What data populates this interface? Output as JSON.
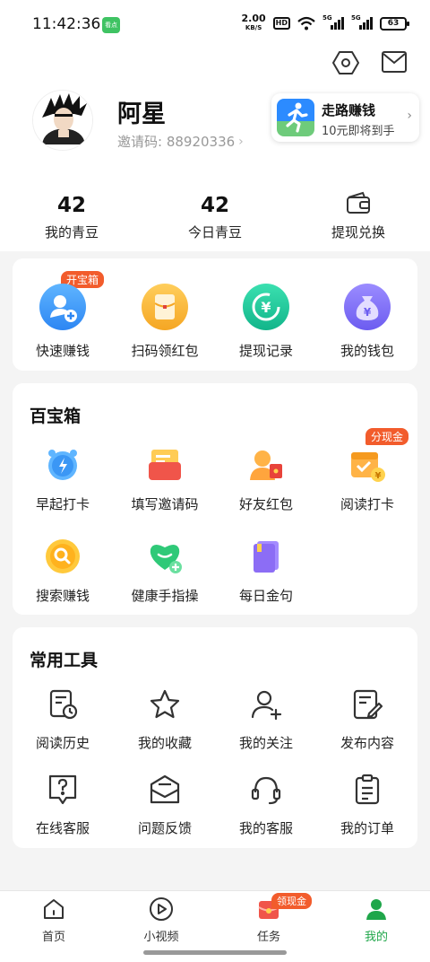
{
  "status_bar": {
    "time": "11:42:36",
    "net_speed_value": "2.00",
    "net_speed_unit": "KB/S",
    "hd_label": "HD",
    "signal1_label": "5G",
    "signal2_label": "5G",
    "battery": "63"
  },
  "profile": {
    "name": "阿星",
    "invite_label": "邀请码: 88920336",
    "walk_card": {
      "title": "走路赚钱",
      "subtitle": "10元即将到手"
    }
  },
  "stats": [
    {
      "value": "42",
      "label": "我的青豆"
    },
    {
      "value": "42",
      "label": "今日青豆"
    }
  ],
  "withdraw_label": "提现兑换",
  "quick_actions": {
    "badge": "开宝箱",
    "items": [
      {
        "label": "快速赚钱",
        "icon": "user-add-icon"
      },
      {
        "label": "扫码领红包",
        "icon": "red-envelope-icon"
      },
      {
        "label": "提现记录",
        "icon": "yen-refresh-icon"
      },
      {
        "label": "我的钱包",
        "icon": "money-bag-icon"
      }
    ]
  },
  "treasure_box": {
    "title": "百宝箱",
    "badge": "分现金",
    "items": [
      {
        "label": "早起打卡",
        "icon": "alarm-clock-icon"
      },
      {
        "label": "填写邀请码",
        "icon": "invite-card-icon"
      },
      {
        "label": "好友红包",
        "icon": "friend-envelope-icon"
      },
      {
        "label": "阅读打卡",
        "icon": "calendar-coin-icon"
      },
      {
        "label": "搜索赚钱",
        "icon": "search-coin-icon"
      },
      {
        "label": "健康手指操",
        "icon": "heart-plus-icon"
      },
      {
        "label": "每日金句",
        "icon": "book-icon"
      }
    ]
  },
  "tools": {
    "title": "常用工具",
    "items": [
      {
        "label": "阅读历史",
        "icon": "history-icon"
      },
      {
        "label": "我的收藏",
        "icon": "star-icon"
      },
      {
        "label": "我的关注",
        "icon": "user-follow-icon"
      },
      {
        "label": "发布内容",
        "icon": "edit-icon"
      },
      {
        "label": "在线客服",
        "icon": "question-icon"
      },
      {
        "label": "问题反馈",
        "icon": "feedback-icon"
      },
      {
        "label": "我的客服",
        "icon": "headset-icon"
      },
      {
        "label": "我的订单",
        "icon": "order-icon"
      }
    ]
  },
  "nav": {
    "badge": "领现金",
    "items": [
      {
        "label": "首页",
        "icon": "home-icon"
      },
      {
        "label": "小视频",
        "icon": "play-icon"
      },
      {
        "label": "任务",
        "icon": "task-icon"
      },
      {
        "label": "我的",
        "icon": "profile-icon"
      }
    ]
  },
  "colors": {
    "accent": "#1fa64a",
    "badge": "#f25c2c",
    "background": "#f4f4f4"
  }
}
